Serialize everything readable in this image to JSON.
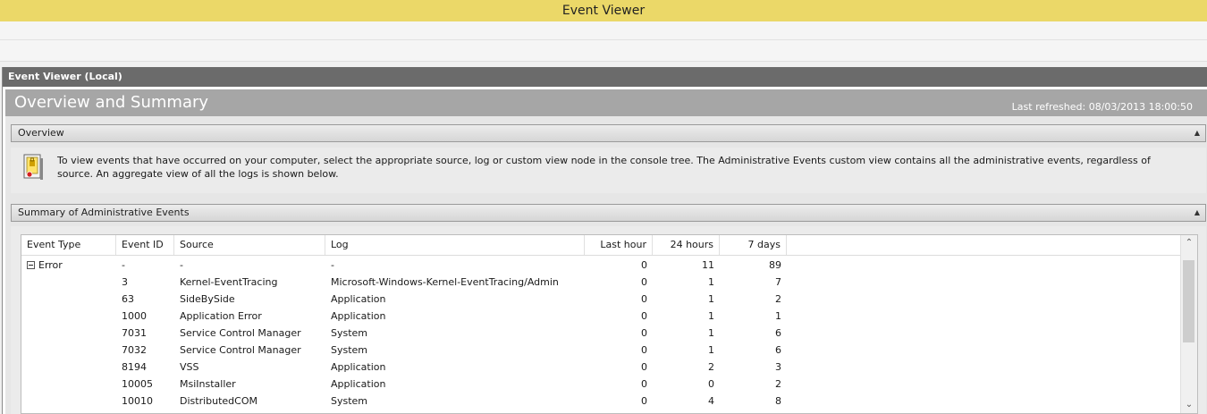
{
  "window": {
    "title": "Event Viewer"
  },
  "pane": {
    "header": "Event Viewer (Local)",
    "title": "Overview and Summary",
    "last_refreshed": "Last refreshed: 08/03/2013 18:00:50"
  },
  "overview": {
    "header": "Overview",
    "collapse_glyph": "▲",
    "description": "To view events that have occurred on your computer, select the appropriate source, log or custom view node in the console tree. The Administrative Events custom view contains all the administrative events, regardless of source. An aggregate view of all the logs is shown below."
  },
  "summary": {
    "header": "Summary of Administrative Events",
    "collapse_glyph": "▲",
    "columns": [
      "Event Type",
      "Event ID",
      "Source",
      "Log",
      "Last hour",
      "24 hours",
      "7 days"
    ],
    "rows": [
      {
        "type": "Error",
        "id": "-",
        "source": "-",
        "log": "-",
        "hour": "0",
        "day": "11",
        "week": "89"
      },
      {
        "type": "",
        "id": "3",
        "source": "Kernel-EventTracing",
        "log": "Microsoft-Windows-Kernel-EventTracing/Admin",
        "hour": "0",
        "day": "1",
        "week": "7"
      },
      {
        "type": "",
        "id": "63",
        "source": "SideBySide",
        "log": "Application",
        "hour": "0",
        "day": "1",
        "week": "2"
      },
      {
        "type": "",
        "id": "1000",
        "source": "Application Error",
        "log": "Application",
        "hour": "0",
        "day": "1",
        "week": "1"
      },
      {
        "type": "",
        "id": "7031",
        "source": "Service Control Manager",
        "log": "System",
        "hour": "0",
        "day": "1",
        "week": "6"
      },
      {
        "type": "",
        "id": "7032",
        "source": "Service Control Manager",
        "log": "System",
        "hour": "0",
        "day": "1",
        "week": "6"
      },
      {
        "type": "",
        "id": "8194",
        "source": "VSS",
        "log": "Application",
        "hour": "0",
        "day": "2",
        "week": "3"
      },
      {
        "type": "",
        "id": "10005",
        "source": "MsiInstaller",
        "log": "Application",
        "hour": "0",
        "day": "0",
        "week": "2"
      },
      {
        "type": "",
        "id": "10010",
        "source": "DistributedCOM",
        "log": "System",
        "hour": "0",
        "day": "4",
        "week": "8"
      }
    ],
    "scroll_up_glyph": "⌃",
    "scroll_down_glyph": "⌄"
  },
  "colors": {
    "titlebar": "#ebd868",
    "pane_header": "#6b6b6b",
    "title_banner": "#a6a6a6"
  }
}
